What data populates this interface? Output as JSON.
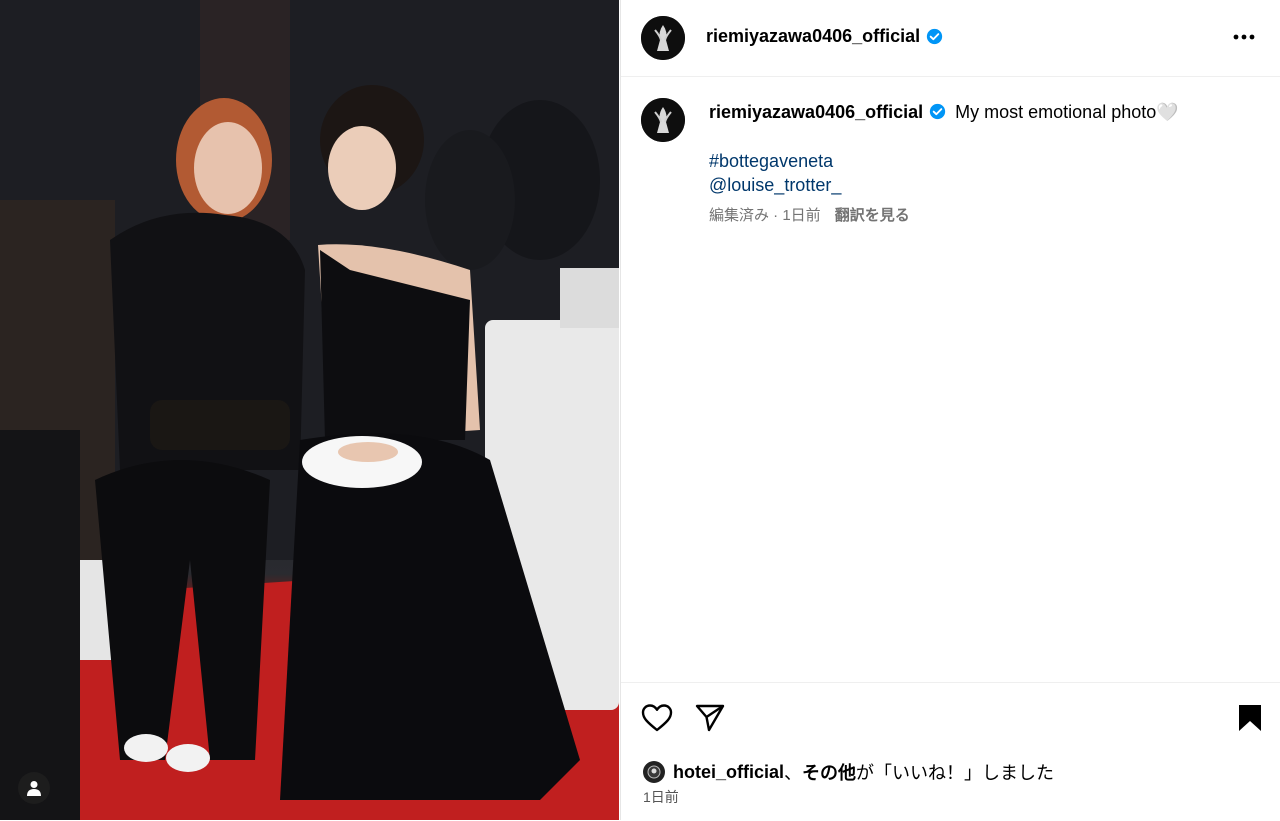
{
  "post": {
    "author": "riemiyazawa0406_official",
    "caption_text": "My most emotional photo",
    "caption_emoji": "🤍",
    "hashtags": [
      "#bottegaveneta",
      "@louise_trotter_"
    ],
    "edited_label": "編集済み · 1日前",
    "translate_label": "翻訳を見る",
    "likes": {
      "user": "hotei_official",
      "separator": "、",
      "others": "その他",
      "suffix": "が「いいね！」しました"
    },
    "timestamp": "1日前"
  },
  "icons": {
    "verified": "verified-badge-icon",
    "more": "more-options-icon",
    "like": "heart-icon",
    "share": "send-icon",
    "save": "bookmark-icon",
    "user_tag": "user-tag-icon"
  },
  "colors": {
    "link": "#00376b",
    "verified": "#0095f6",
    "muted": "#737373",
    "carpet": "#c21f1f"
  }
}
